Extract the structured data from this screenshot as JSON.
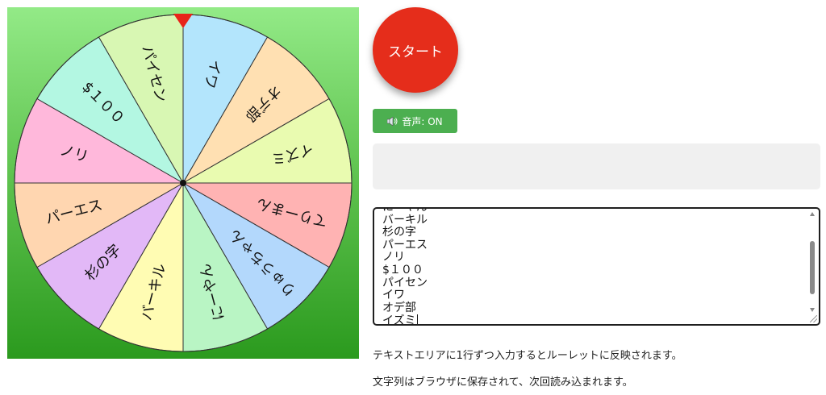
{
  "wheel": {
    "pointer_color": "#e8231a",
    "border_color": "#333333",
    "segments": [
      {
        "label": "イワ",
        "color": "#b3e5fc"
      },
      {
        "label": "オデ部",
        "color": "#ffe0b2"
      },
      {
        "label": "イズミ",
        "color": "#e9fbb0"
      },
      {
        "label": "てりーまん",
        "color": "#ffb3b3"
      },
      {
        "label": "りゅうちゃん",
        "color": "#b3d8fc"
      },
      {
        "label": "にーやん",
        "color": "#b9f5c4"
      },
      {
        "label": "バーキル",
        "color": "#fffcb3"
      },
      {
        "label": "杉の字",
        "color": "#e2b8f7"
      },
      {
        "label": "パーエス",
        "color": "#ffd6b0"
      },
      {
        "label": "ノリ",
        "color": "#ffb8db"
      },
      {
        "label": "$１００",
        "color": "#b3f7e2"
      },
      {
        "label": "パイセン",
        "color": "#d8f7b3"
      }
    ]
  },
  "start_button": {
    "label": "スタート",
    "color": "#e52d1b"
  },
  "sound_button": {
    "label": "音声: ON",
    "icon": "speaker-icon",
    "color": "#4caf50"
  },
  "result_text": "",
  "textarea": {
    "visible_lines": [
      "にーやん",
      "バーキル",
      "杉の字",
      "パーエス",
      "ノリ",
      "$１００",
      "パイセン",
      "イワ",
      "オデ部",
      "イズミ"
    ]
  },
  "help": {
    "line1": "テキストエリアに1行ずつ入力するとルーレットに反映されます。",
    "line2": "文字列はブラウザに保存されて、次回読み込まれます。"
  }
}
